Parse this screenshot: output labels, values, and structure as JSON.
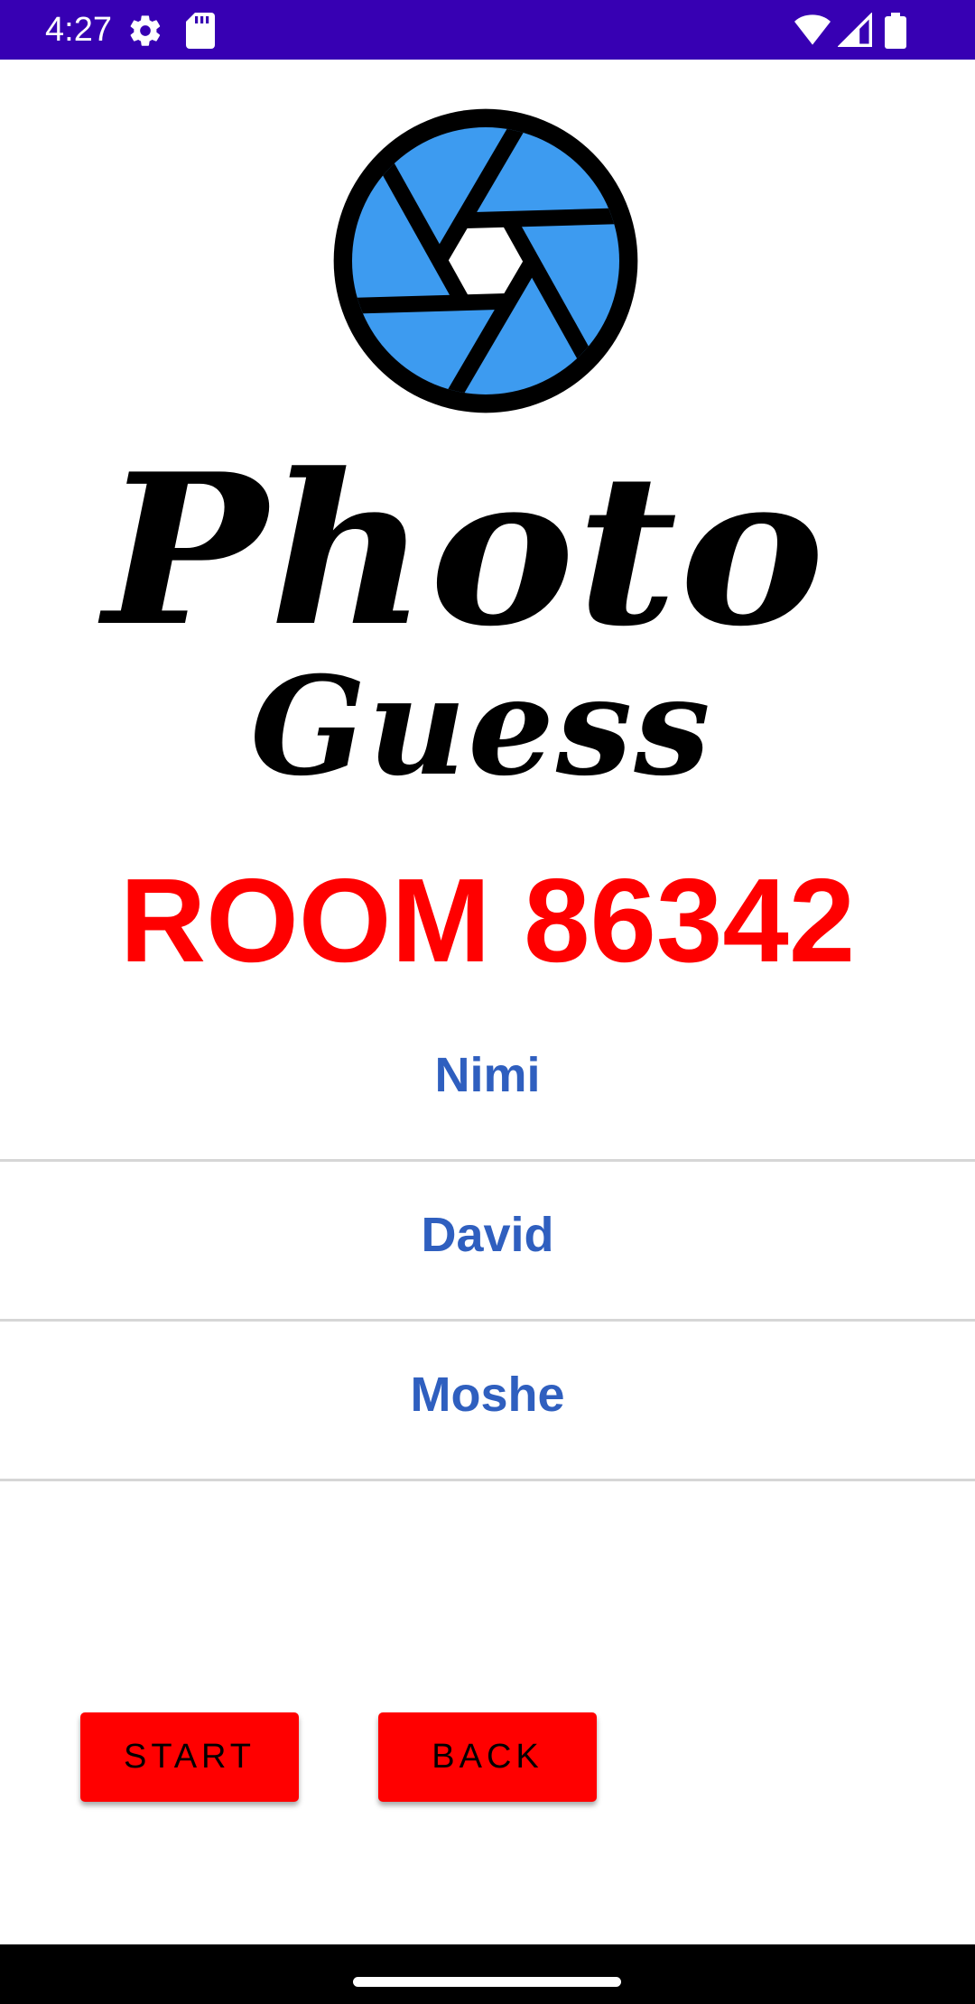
{
  "status_bar": {
    "time": "4:27",
    "icons": [
      "settings-icon",
      "sdcard-icon",
      "wifi-icon",
      "signal-icon",
      "battery-icon"
    ],
    "background": "#3700b3"
  },
  "logo": {
    "icon": "camera-aperture-icon",
    "word1": "Photo",
    "word2": "Guess",
    "aperture_color": "#3d9bf0"
  },
  "room": {
    "title": "ROOM 86342",
    "color": "#ff0000"
  },
  "players": [
    {
      "name": "Nimi"
    },
    {
      "name": "David"
    },
    {
      "name": "Moshe"
    }
  ],
  "player_name_color": "#2f5fbf",
  "buttons": {
    "start_label": "START",
    "back_label": "BACK",
    "color": "#ff0000"
  }
}
